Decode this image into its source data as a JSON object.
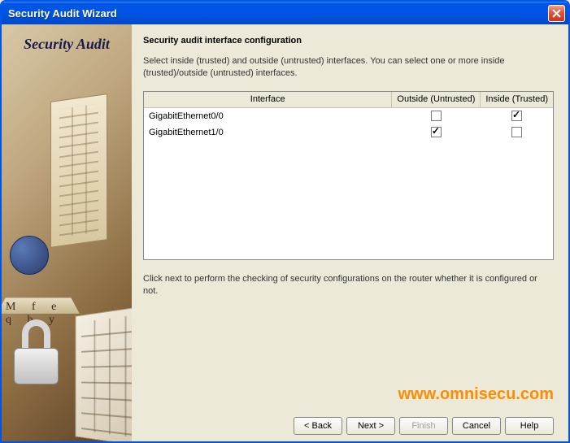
{
  "window": {
    "title": "Security Audit Wizard"
  },
  "sidebar": {
    "title": "Security Audit"
  },
  "main": {
    "heading": "Security audit interface configuration",
    "intro": "Select inside (trusted) and outside (untrusted) interfaces. You can select one or more inside (trusted)/outside (untrusted) interfaces.",
    "outro": "Click next to perform the checking of security configurations on the router whether it is configured or not.",
    "columns": {
      "interface": "Interface",
      "outside": "Outside (Untrusted)",
      "inside": "Inside (Trusted)"
    },
    "rows": [
      {
        "name": "GigabitEthernet0/0",
        "outside": false,
        "inside": true
      },
      {
        "name": "GigabitEthernet1/0",
        "outside": true,
        "inside": false
      }
    ]
  },
  "buttons": {
    "back": "< Back",
    "next": "Next >",
    "finish": "Finish",
    "cancel": "Cancel",
    "help": "Help"
  },
  "watermark": "www.omnisecu.com"
}
